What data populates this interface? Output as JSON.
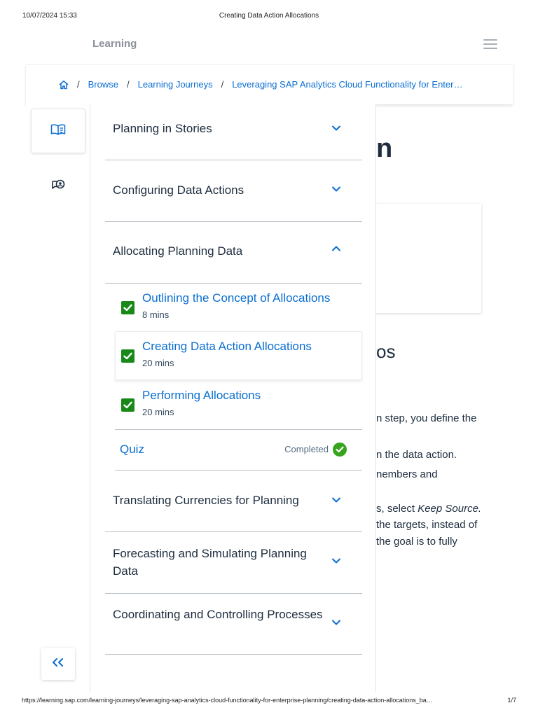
{
  "print_header": {
    "date": "10/07/2024 15:33",
    "title": "Creating Data Action Allocations"
  },
  "print_footer": {
    "url": "https://learning.sap.com/learning-journeys/leveraging-sap-analytics-cloud-functionality-for-enterprise-planning/creating-data-action-allocations_ba…",
    "page": "1/7"
  },
  "header": {
    "brand": "Learning",
    "menu_icon": "hamburger-icon"
  },
  "breadcrumb": {
    "home_icon": "home-icon",
    "separator": "/",
    "items": [
      "Browse",
      "Learning Journeys",
      "Leveraging SAP Analytics Cloud Functionality for Enter…"
    ]
  },
  "rail": {
    "items": [
      {
        "icon": "book-icon",
        "active": true
      },
      {
        "icon": "discussion-icon",
        "active": false
      }
    ]
  },
  "background": {
    "heading_fragment": "n",
    "subheading_fragment": "os",
    "paragraph_fragments": [
      "n step, you define the",
      "n the data action.",
      "nembers and",
      "s, select ",
      "Keep Source.",
      " the targets, instead of",
      " the goal is to fully"
    ]
  },
  "panel": {
    "sections_before": [
      {
        "label": "Planning in Stories",
        "expanded": false
      },
      {
        "label": "Configuring Data Actions",
        "expanded": false
      },
      {
        "label": "Allocating Planning Data",
        "expanded": true
      }
    ],
    "lessons": [
      {
        "title": "Outlining the Concept of Allocations",
        "duration": "8 mins",
        "completed": true,
        "current": false
      },
      {
        "title": "Creating Data Action Allocations",
        "duration": "20 mins",
        "completed": true,
        "current": true
      },
      {
        "title": "Performing Allocations",
        "duration": "20 mins",
        "completed": true,
        "current": false
      }
    ],
    "quiz": {
      "label": "Quiz",
      "status": "Completed"
    },
    "sections_after": [
      {
        "label": "Translating Currencies for Planning",
        "expanded": false
      },
      {
        "label": "Forecasting and Simulating Planning Data",
        "expanded": false
      },
      {
        "label": "Coordinating and Controlling Processes",
        "expanded": false
      }
    ]
  },
  "collapse_button": {
    "label": "<<"
  },
  "colors": {
    "link": "#0a6ed1",
    "success": "#188918",
    "text": "#1d2d3e",
    "divider": "#b9c0c6"
  }
}
